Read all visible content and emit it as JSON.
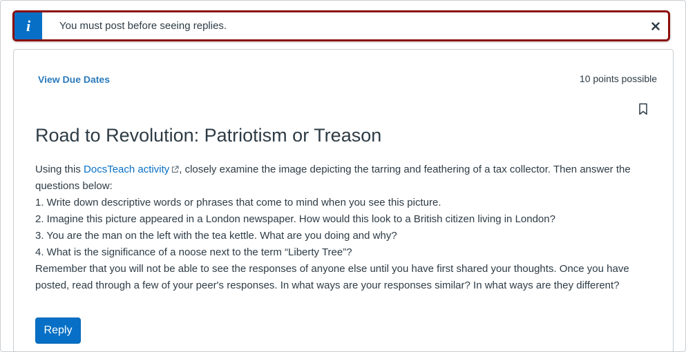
{
  "alert": {
    "icon": "info-icon",
    "icon_glyph": "i",
    "message": "You must post before seeing replies.",
    "close_glyph": "×",
    "accent_color": "#0770c6",
    "border_color": "#8c0e0e"
  },
  "assignment": {
    "due_dates_link": "View Due Dates",
    "points": "10 points possible",
    "title": "Road to Revolution: Patriotism or Treason",
    "intro_before_link": "Using this ",
    "link_text": "DocsTeach activity",
    "intro_after_link": ", closely examine the image depicting the tarring and feathering of a tax collector. Then answer the questions below:",
    "questions": [
      "1. Write down descriptive words or phrases that come to mind when you see this picture.",
      "2. Imagine this picture appeared in a London newspaper. How would this look to a British citizen living in London?",
      "3. You are the man on the left with the tea kettle. What are you doing and why?",
      "4. What is the significance of a noose next to the term “Liberty Tree”?"
    ],
    "closing": "Remember that you will not be able to see the responses of anyone else until you have first shared your thoughts. Once you have posted, read through a few of your peer's responses. In what ways are your responses similar? In what ways are they different?",
    "reply_label": "Reply"
  },
  "icons": {
    "bookmark": "bookmark-icon",
    "external_link": "external-link-icon",
    "close": "close-icon"
  }
}
